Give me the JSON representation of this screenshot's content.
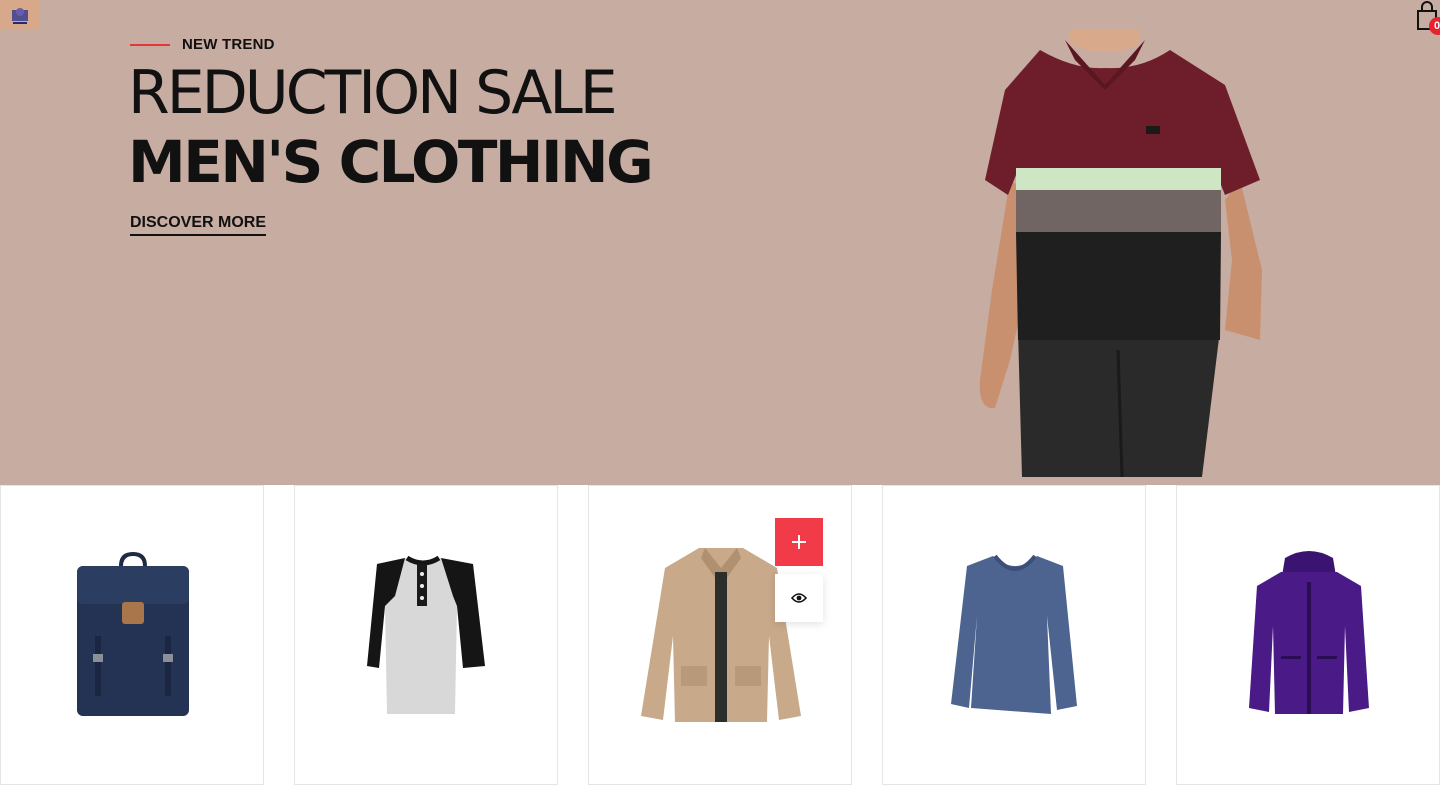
{
  "header": {
    "logo_icon": "store-logo-icon",
    "cart_icon": "shopping-bag-icon",
    "cart_count": "0"
  },
  "hero": {
    "eyebrow": "NEW TREND",
    "headline_light": "REDUCTION SALE",
    "headline_bold": "MEN'S CLOTHING",
    "cta": "DISCOVER MORE",
    "background": "#c7aca2",
    "accent": "#e53637"
  },
  "products": [
    {
      "icon": "backpack-icon"
    },
    {
      "icon": "henley-shirt-icon"
    },
    {
      "icon": "jacket-icon",
      "tools": {
        "add_icon": "plus-icon",
        "view_icon": "eye-icon"
      }
    },
    {
      "icon": "long-sleeve-shirt-icon"
    },
    {
      "icon": "hooded-jacket-icon"
    }
  ],
  "colors": {
    "add_button": "#f23b48",
    "badge": "#e8212f"
  }
}
